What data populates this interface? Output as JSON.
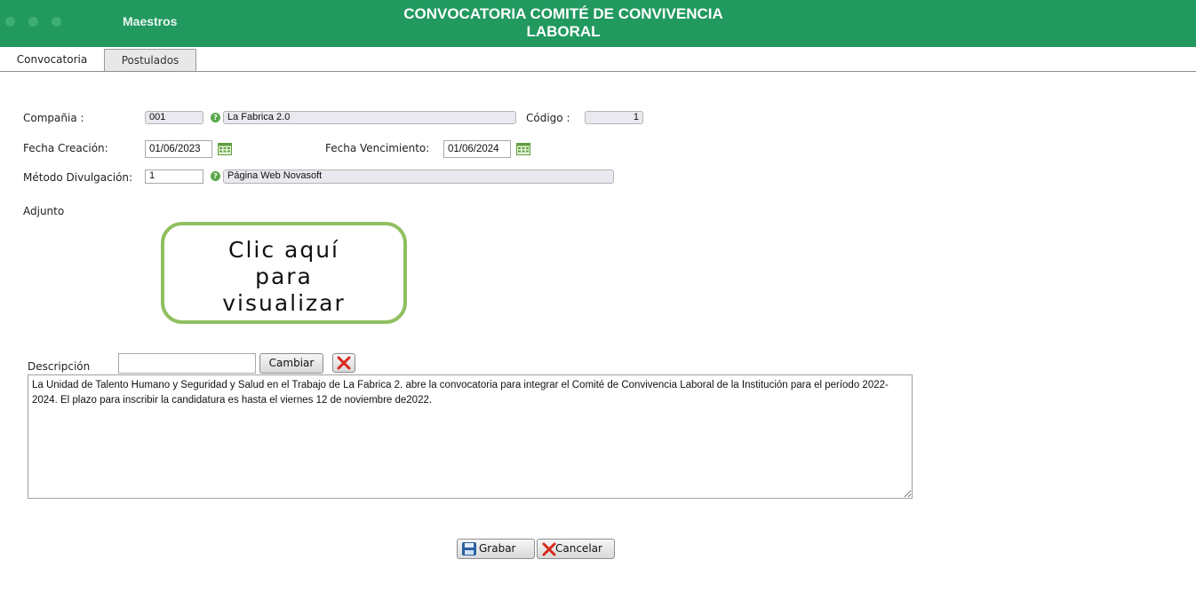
{
  "header": {
    "menu_title": "Maestros",
    "title_line1": "CONVOCATORIA COMITÉ DE CONVIVENCIA",
    "title_line2": "LABORAL",
    "accent_color": "#21995f"
  },
  "tabs": [
    {
      "label": "Convocatoria",
      "active": true
    },
    {
      "label": "Postulados",
      "active": false
    }
  ],
  "form": {
    "company_label": "Compañia :",
    "company_code": "001",
    "company_name": "La Fabrica 2.0",
    "code_label": "Código :",
    "code_value": "1",
    "created_label": "Fecha Creación:",
    "created_value": "01/06/2023",
    "due_label": "Fecha Vencimiento:",
    "due_value": "01/06/2024",
    "method_label": "Método Divulgación:",
    "method_code": "1",
    "method_name": "Página Web Novasoft",
    "attachment_label": "Adjunto",
    "attachment_text_line1": "Clic aquí",
    "attachment_text_line2": "para",
    "attachment_text_line3": "visualizar",
    "description_label": "Descripción",
    "description_input": "",
    "change_button": "Cambiar",
    "description_text": "La Unidad de Talento Humano y Seguridad y Salud en el Trabajo de La Fabrica 2. abre la convocatoria para integrar el Comité de Convivencia Laboral de la Institución para el período 2022-2024. El plazo para inscribir la candidatura es hasta el viernes 12 de noviembre de2022."
  },
  "footer": {
    "save_button": "Grabar",
    "cancel_button": "Cancelar"
  },
  "icons": {
    "help": "help-circle-icon",
    "calendar": "calendar-icon",
    "clear": "red-x-icon",
    "save": "floppy-disk-icon",
    "cancel": "red-x-icon"
  }
}
